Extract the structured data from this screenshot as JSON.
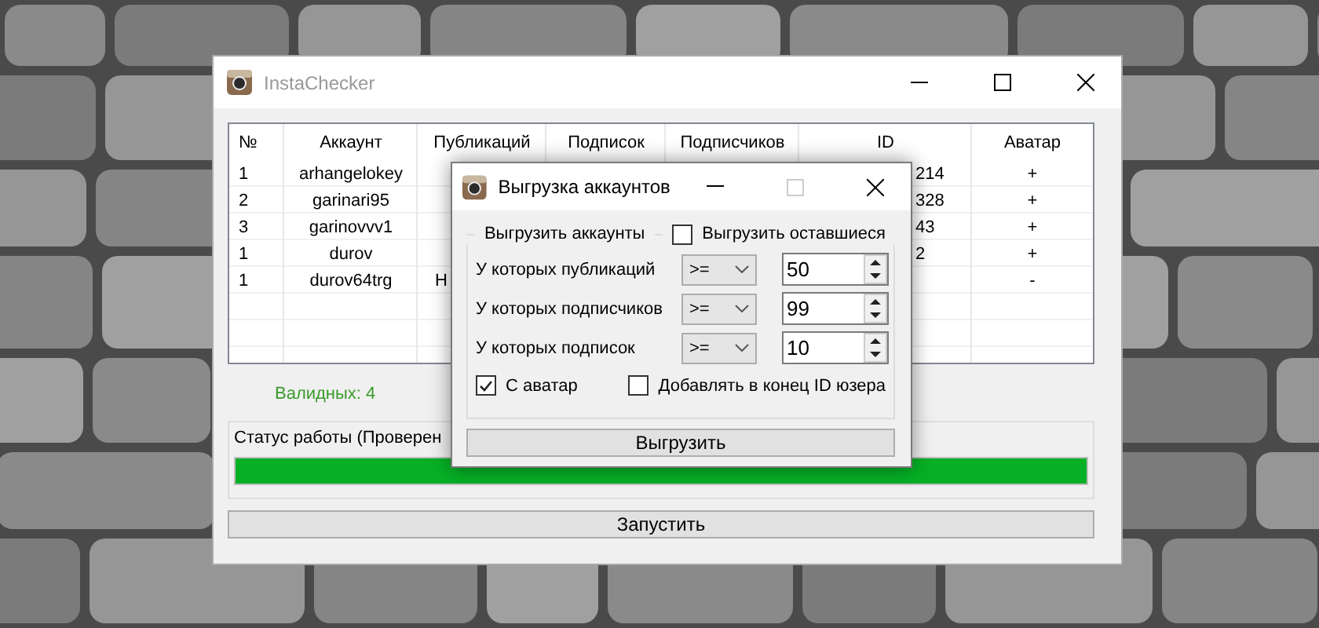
{
  "window": {
    "title": "InstaChecker"
  },
  "table": {
    "columns": [
      "№",
      "Аккаунт",
      "Публикаций",
      "Подписок",
      "Подписчиков",
      "ID",
      "Аватар"
    ],
    "rows": [
      {
        "num": "1",
        "account": "arhangelokey",
        "id": "214",
        "avatar": "+"
      },
      {
        "num": "2",
        "account": "garinari95",
        "id": "328",
        "avatar": "+"
      },
      {
        "num": "3",
        "account": "garinovvv1",
        "id": "43",
        "avatar": "+"
      },
      {
        "num": "1",
        "account": "durov",
        "id": "2",
        "avatar": "+"
      },
      {
        "num": "1",
        "account": "durov64trg",
        "publications": "Н",
        "avatar": "-"
      }
    ]
  },
  "valid_count": "Валидных: 4",
  "status": {
    "label": "Статус работы (Проверен",
    "level": 1
  },
  "start_button": "Запустить",
  "dialog": {
    "title": "Выгрузка аккаунтов",
    "group_label": "Выгрузить аккаунты",
    "export_remaining": {
      "label": "Выгрузить оставшиеся",
      "checked": false
    },
    "filters": [
      {
        "label": "У которых публикаций",
        "operator": ">=",
        "value": "50"
      },
      {
        "label": "У которых подписчиков",
        "operator": ">=",
        "value": "99"
      },
      {
        "label": "У которых подписок",
        "operator": ">=",
        "value": "10"
      }
    ],
    "with_avatar": {
      "label": "С аватар",
      "checked": true
    },
    "append_id": {
      "label": "Добавлять в конец ID юзера",
      "checked": false
    },
    "button": "Выгрузить"
  }
}
